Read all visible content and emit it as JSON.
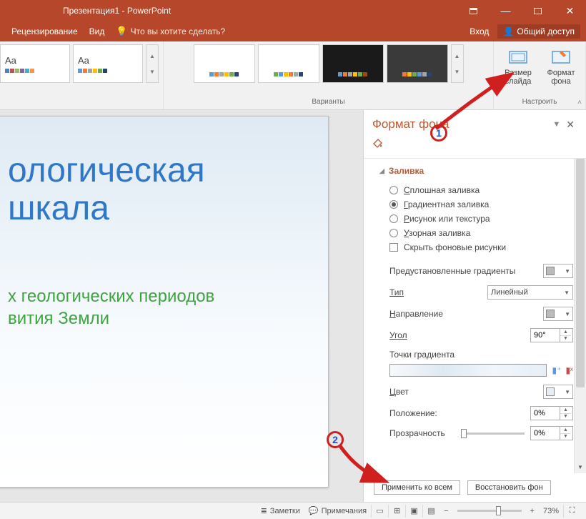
{
  "titlebar": {
    "title": "Презентация1 - PowerPoint"
  },
  "ribbon_tabs": {
    "review": "Рецензирование",
    "view": "Вид",
    "tell_me": "Что вы хотите сделать?"
  },
  "top_right": {
    "signin": "Вход",
    "share": "Общий доступ"
  },
  "ribbon": {
    "variants_label": "Варианты",
    "customize_label": "Настроить",
    "size_btn": "Размер слайда",
    "size_caret": "▾",
    "format_btn": "Формат фона",
    "theme_aa": "Aa"
  },
  "slide": {
    "title_line1": "ологическая",
    "title_line2": "шкала",
    "sub_line1": "х геологических периодов",
    "sub_line2": "вития Земли"
  },
  "pane": {
    "title": "Формат фона",
    "section_fill": "Заливка",
    "fill_solid": "Сплошная заливка",
    "fill_gradient": "Градиентная заливка",
    "fill_picture": "Рисунок или текстура",
    "fill_pattern": "Узорная заливка",
    "hide_bg": "Скрыть фоновые рисунки",
    "preset": "Предустановленные градиенты",
    "type_lbl": "Тип",
    "type_val": "Линейный",
    "direction": "Направление",
    "angle": "Угол",
    "angle_val": "90°",
    "stops": "Точки градиента",
    "color": "Цвет",
    "position": "Положение:",
    "position_val": "0%",
    "transparency": "Прозрачность",
    "transparency_val": "0%",
    "apply_all": "Применить ко всем",
    "reset": "Восстановить фон"
  },
  "status": {
    "notes": "Заметки",
    "comments": "Примечания",
    "zoom": "73%"
  },
  "annotations": {
    "c1": "1",
    "c2": "2"
  }
}
